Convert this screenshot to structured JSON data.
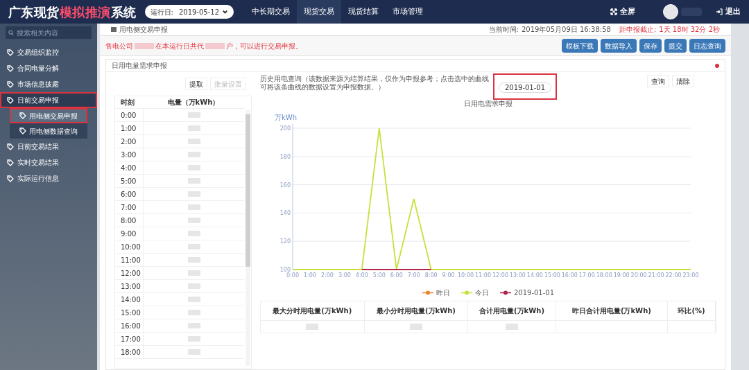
{
  "header": {
    "title": "广东现货",
    "title_highlight": "模拟推演",
    "title_end": "系统",
    "run_day_label": "运行日:",
    "run_day": "2019-05-12",
    "nav": [
      {
        "label": "中长期交易",
        "selected": false
      },
      {
        "label": "现货交易",
        "selected": true
      },
      {
        "label": "现货结算",
        "selected": false
      },
      {
        "label": "市场管理",
        "selected": false
      }
    ],
    "fullscreen": "全屏",
    "logout": "退出"
  },
  "sidebar": {
    "search_placeholder": "搜索相关内容",
    "items": [
      {
        "label": "交易组织监控",
        "expanded": false,
        "highlighted": false
      },
      {
        "label": "合同电量分解",
        "expanded": false,
        "highlighted": false
      },
      {
        "label": "市场信息披露",
        "expanded": false,
        "highlighted": false
      },
      {
        "label": "日前交易申报",
        "expanded": true,
        "highlighted": true,
        "children": [
          {
            "label": "用电侧交易申报",
            "selected": true,
            "highlighted": true
          },
          {
            "label": "用电侧数据查询",
            "selected": false,
            "highlighted": false
          }
        ]
      },
      {
        "label": "日前交易结果",
        "expanded": false,
        "highlighted": false
      },
      {
        "label": "实时交易结果",
        "expanded": false,
        "highlighted": false
      },
      {
        "label": "实际运行信息",
        "expanded": false,
        "highlighted": false
      }
    ]
  },
  "breadcrumb": "用电侧交易申报",
  "clock": {
    "label": "当前时间:",
    "value": "2019年05月09日 16:38:58",
    "deadline_label": "距申报截止:",
    "deadline": "1天 18时 32分 2秒"
  },
  "notice": [
    "售电公司",
    "在本运行日共代",
    "户，可以进行交易申报。"
  ],
  "toolbar": [
    "模板下载",
    "数据导入",
    "保存",
    "提交",
    "日志查询"
  ],
  "panel": {
    "title": "日用电量需求申报",
    "table_buttons": [
      {
        "label": "提取",
        "disabled": false
      },
      {
        "label": "批量设置",
        "disabled": true
      }
    ],
    "columns": [
      "时刻",
      "电量（万kWh）"
    ],
    "rows": [
      "0:00",
      "1:00",
      "2:00",
      "3:00",
      "4:00",
      "5:00",
      "6:00",
      "7:00",
      "8:00",
      "9:00",
      "10:00",
      "11:00",
      "12:00",
      "13:00",
      "14:00",
      "15:00",
      "16:00",
      "17:00",
      "18:00"
    ],
    "history_note": "历史用电查询（该数据来源为结算结果，仅作为申报参考；点击选中的曲线可将该条曲线的数据设置为申报数据。）",
    "history_date": {
      "value": "2019-01-01",
      "highlighted": true
    },
    "query_buttons": [
      "查询",
      "清除"
    ],
    "chart_data": {
      "type": "line",
      "title": "日用电需求申报",
      "ylabel": "万kWh",
      "categories": [
        "0:00",
        "1:00",
        "2:00",
        "3:00",
        "4:00",
        "5:00",
        "6:00",
        "7:00",
        "8:00",
        "9:00",
        "10:00",
        "11:00",
        "12:00",
        "13:00",
        "14:00",
        "15:00",
        "16:00",
        "17:00",
        "18:00",
        "19:00",
        "20:00",
        "21:00",
        "22:00",
        "23:00"
      ],
      "ylim": [
        100,
        200
      ],
      "yticks": [
        100,
        120,
        140,
        160,
        180,
        200
      ],
      "grid": true,
      "legend": true,
      "series": [
        {
          "name": "昨日",
          "color": "#e8872f",
          "values": [
            null,
            null,
            null,
            null,
            null,
            null,
            null,
            null,
            null,
            null,
            null,
            null,
            null,
            null,
            null,
            null,
            null,
            null,
            null,
            null,
            null,
            null,
            null,
            null
          ]
        },
        {
          "name": "今日",
          "color": "#c8e03a",
          "values": [
            100,
            100,
            100,
            100,
            100,
            200,
            100,
            150,
            100,
            100,
            100,
            100,
            100,
            100,
            100,
            100,
            100,
            100,
            100,
            100,
            100,
            100,
            100,
            100
          ]
        },
        {
          "name": "2019-01-01",
          "color": "#b0264a",
          "values": [
            null,
            null,
            null,
            null,
            100,
            100,
            100,
            100,
            100,
            null,
            null,
            null,
            null,
            null,
            null,
            null,
            null,
            null,
            null,
            null,
            null,
            null,
            null,
            null
          ]
        }
      ]
    },
    "summary_columns": [
      "最大分时用电量(万kWh)",
      "最小分时用电量(万kWh)",
      "合计用电量(万kWh)",
      "昨日合计用电量(万kWh)",
      "环比(%)"
    ]
  }
}
